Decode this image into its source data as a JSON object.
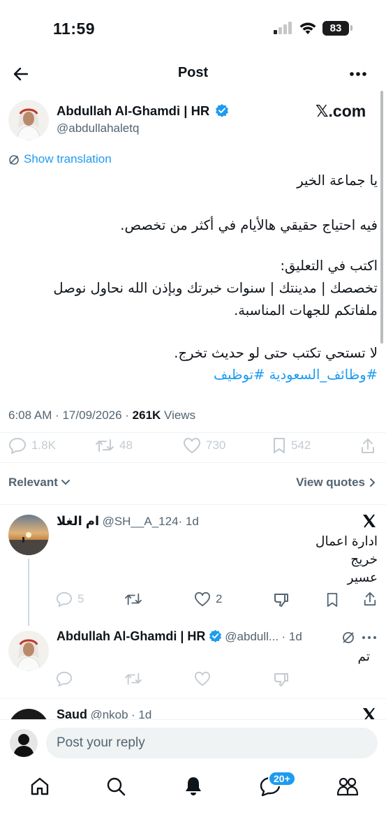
{
  "status_bar": {
    "time": "11:59",
    "battery": "83"
  },
  "header": {
    "title": "Post"
  },
  "tweet": {
    "author_name": "Abdullah Al-Ghamdi | HR",
    "author_handle": "@abdullahaletq",
    "source_label": "𝕏.com",
    "show_translation": "Show translation",
    "lines": {
      "l1": "يا جماعة الخير",
      "l2": "فيه احتياج حقيقي هالأيام في أكثر من تخصص.",
      "l3": "اكتب في التعليق:",
      "l4": "تخصصك | مدينتك | سنوات خبرتك وبإذن الله نحاول نوصل",
      "l5": "ملفاتكم للجهات المناسبة.",
      "l6": "لا تستحي تكتب حتى لو حديث تخرج.",
      "hashtags": "#وظائف_السعودية #توظيف"
    },
    "timestamp": "6:08 AM · 17/09/2026 · ",
    "views_count": "261K",
    "views_label": " Views",
    "stats": {
      "replies": "1.8K",
      "reposts": "48",
      "likes": "730",
      "bookmarks": "542"
    }
  },
  "filters": {
    "relevant": "Relevant",
    "view_quotes": "View quotes"
  },
  "replies": [
    {
      "name": "ام الغلا",
      "handle": "@SH__A_124",
      "time": "· 1d",
      "lines": [
        "ادارة اعمال",
        "خريج",
        "عسير"
      ],
      "replies": "5",
      "reposts": "",
      "likes": "2"
    },
    {
      "name": "Abdullah Al-Ghamdi | HR",
      "handle": "@abdull...",
      "time": "· 1d",
      "lines": [
        "تم"
      ]
    },
    {
      "name": "Saud",
      "handle": "@nkob",
      "time": "· 1d"
    }
  ],
  "composer": {
    "placeholder": "Post your reply"
  },
  "nav": {
    "messages_badge": "20+"
  },
  "colors": {
    "accent": "#1d9bf0",
    "text": "#0f1419",
    "muted": "#536471"
  }
}
